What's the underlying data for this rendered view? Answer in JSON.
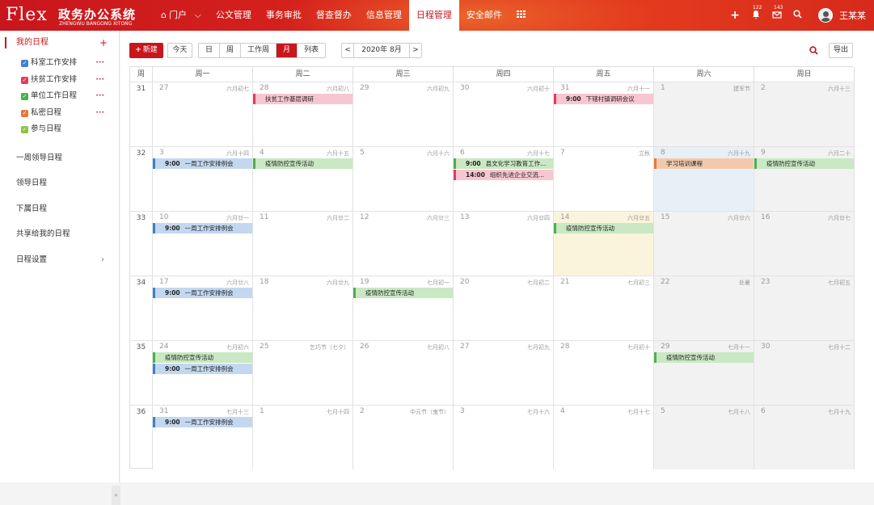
{
  "app": {
    "logo_text": "Flex",
    "title_cn": "政务办公系统",
    "title_py": "ZHENGWU BANGONG XITONG"
  },
  "nav": [
    {
      "label": "门户",
      "icon": "home-icon",
      "has_caret": true
    },
    {
      "label": "公文管理"
    },
    {
      "label": "事务审批"
    },
    {
      "label": "督查督办"
    },
    {
      "label": "信息管理"
    },
    {
      "label": "日程管理",
      "active": true
    },
    {
      "label": "安全邮件"
    }
  ],
  "header_right": {
    "notify_count": "122",
    "mail_count": "143",
    "user_name": "王某某"
  },
  "sidebar": {
    "my_schedule": "我的日程",
    "calendars": [
      {
        "label": "科室工作安排",
        "color": "#3f7fd0"
      },
      {
        "label": "扶贫工作安排",
        "color": "#e43a5c"
      },
      {
        "label": "单位工作日程",
        "color": "#4caf50"
      },
      {
        "label": "私密日程",
        "color": "#e9773a"
      },
      {
        "label": "参与日程",
        "color": "#8bc34a"
      }
    ],
    "groups": [
      "一周领导日程",
      "领导日程",
      "下属日程",
      "共享给我的日程",
      "日程设置"
    ]
  },
  "toolbar": {
    "new_label": "新建",
    "today_label": "今天",
    "views": [
      "日",
      "周",
      "工作周",
      "月",
      "列表"
    ],
    "active_view": "月",
    "current_date": "2020年 8月",
    "export_label": "导出"
  },
  "calendar": {
    "week_col_label": "周",
    "weekdays": [
      "周一",
      "周二",
      "周三",
      "周四",
      "周五",
      "周六",
      "周日"
    ],
    "weeks": [
      {
        "no": "31",
        "days": [
          {
            "d": "27",
            "l": "六月初七"
          },
          {
            "d": "28",
            "l": "六月初八",
            "ev": [
              {
                "t": "",
                "text": "扶贫工作基层调研",
                "c": "pink"
              }
            ]
          },
          {
            "d": "29",
            "l": "六月初九"
          },
          {
            "d": "30",
            "l": "六月初十"
          },
          {
            "d": "31",
            "l": "六月十一",
            "ev": [
              {
                "t": "9:00",
                "text": "下辖村镇调研会议",
                "c": "pink"
              }
            ]
          },
          {
            "d": "1",
            "l": "建军节",
            "bg": "gray"
          },
          {
            "d": "2",
            "l": "六月十三",
            "bg": "gray"
          }
        ]
      },
      {
        "no": "32",
        "days": [
          {
            "d": "3",
            "l": "六月十四",
            "ev": [
              {
                "t": "9:00",
                "text": "一周工作安排例会",
                "c": "blue"
              }
            ]
          },
          {
            "d": "4",
            "l": "六月十五",
            "ev": [
              {
                "t": "",
                "text": "疫情防控宣传活动",
                "c": "green"
              }
            ]
          },
          {
            "d": "5",
            "l": "六月十六"
          },
          {
            "d": "6",
            "l": "六月十七",
            "ev": [
              {
                "t": "9:00",
                "text": "县文化学习教育工作...",
                "c": "green"
              },
              {
                "t": "14:00",
                "text": "组织先进企业交流...",
                "c": "pink"
              }
            ]
          },
          {
            "d": "7",
            "l": "立秋"
          },
          {
            "d": "8",
            "l": "六月十九",
            "bg": "blue",
            "ev": [
              {
                "t": "",
                "text": "学习培训课程",
                "c": "orange"
              }
            ]
          },
          {
            "d": "9",
            "l": "六月二十",
            "bg": "gray",
            "ev": [
              {
                "t": "",
                "text": "疫情防控宣传活动",
                "c": "green"
              }
            ]
          }
        ]
      },
      {
        "no": "33",
        "days": [
          {
            "d": "10",
            "l": "六月廿一",
            "ev": [
              {
                "t": "9:00",
                "text": "一周工作安排例会",
                "c": "blue"
              }
            ]
          },
          {
            "d": "11",
            "l": "六月廿二"
          },
          {
            "d": "12",
            "l": "六月廿三"
          },
          {
            "d": "13",
            "l": "六月廿四"
          },
          {
            "d": "14",
            "l": "六月廿五",
            "bg": "yel",
            "ev": [
              {
                "t": "",
                "text": "疫情防控宣传活动",
                "c": "green"
              }
            ]
          },
          {
            "d": "15",
            "l": "六月廿六",
            "bg": "gray"
          },
          {
            "d": "16",
            "l": "六月廿七",
            "bg": "gray"
          }
        ]
      },
      {
        "no": "34",
        "days": [
          {
            "d": "17",
            "l": "六月廿八",
            "ev": [
              {
                "t": "9:00",
                "text": "一周工作安排例会",
                "c": "blue"
              }
            ]
          },
          {
            "d": "18",
            "l": "六月廿九"
          },
          {
            "d": "19",
            "l": "七月初一",
            "ev": [
              {
                "t": "",
                "text": "疫情防控宣传活动",
                "c": "green"
              }
            ]
          },
          {
            "d": "20",
            "l": "七月初二"
          },
          {
            "d": "21",
            "l": "七月初三"
          },
          {
            "d": "22",
            "l": "处暑",
            "bg": "gray"
          },
          {
            "d": "23",
            "l": "七月初五",
            "bg": "gray"
          }
        ]
      },
      {
        "no": "35",
        "days": [
          {
            "d": "24",
            "l": "七月初六",
            "ev": [
              {
                "t": "",
                "text": "疫情防控宣传活动",
                "c": "green"
              },
              {
                "t": "9:00",
                "text": "一周工作安排例会",
                "c": "blue"
              }
            ]
          },
          {
            "d": "25",
            "l": "乞巧节（七夕）"
          },
          {
            "d": "26",
            "l": "七月初八"
          },
          {
            "d": "27",
            "l": "七月初九"
          },
          {
            "d": "28",
            "l": "七月初十"
          },
          {
            "d": "29",
            "l": "七月十一",
            "bg": "gray",
            "ev": [
              {
                "t": "",
                "text": "疫情防控宣传活动",
                "c": "green"
              }
            ]
          },
          {
            "d": "30",
            "l": "七月十二",
            "bg": "gray"
          }
        ]
      },
      {
        "no": "36",
        "days": [
          {
            "d": "31",
            "l": "七月十三",
            "ev": [
              {
                "t": "9:00",
                "text": "一周工作安排例会",
                "c": "blue"
              }
            ]
          },
          {
            "d": "1",
            "l": "七月十四"
          },
          {
            "d": "2",
            "l": "中元节（鬼节）"
          },
          {
            "d": "3",
            "l": "七月十六"
          },
          {
            "d": "4",
            "l": "七月十七"
          },
          {
            "d": "5",
            "l": "七月十八",
            "bg": "gray"
          },
          {
            "d": "6",
            "l": "七月十九",
            "bg": "gray"
          }
        ]
      }
    ]
  }
}
